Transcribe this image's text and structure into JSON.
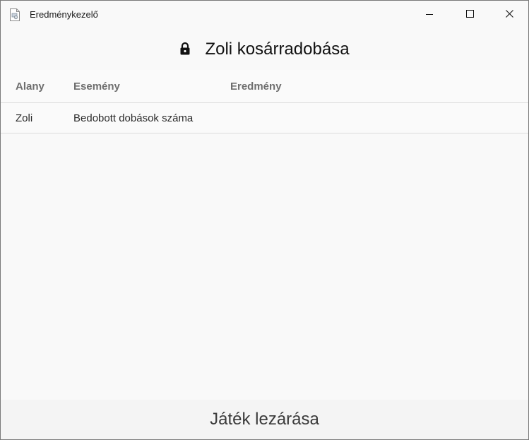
{
  "window": {
    "title": "Eredménykezelő",
    "app_icon": "document-app-icon",
    "controls": [
      "minimize-icon",
      "maximize-icon",
      "close-icon"
    ]
  },
  "header": {
    "icon": "lock-icon",
    "title": "Zoli kosárradobása"
  },
  "table": {
    "columns": [
      "Alany",
      "Esemény",
      "Eredmény"
    ],
    "rows": [
      {
        "alany": "Zoli",
        "esemeny": "Bedobott dobások száma",
        "eredmeny": ""
      }
    ]
  },
  "footer": {
    "button_label": "Játék lezárása"
  }
}
